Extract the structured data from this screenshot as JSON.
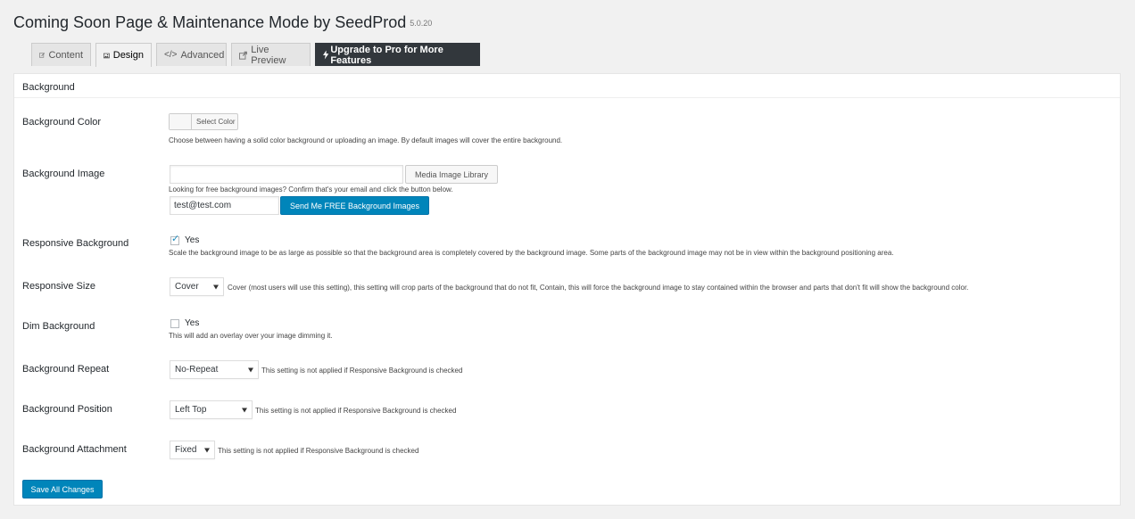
{
  "header": {
    "title": "Coming Soon Page & Maintenance Mode by SeedProd",
    "version": "5.0.20"
  },
  "tabs": [
    {
      "label": "Content",
      "icon": "edit-icon"
    },
    {
      "label": "Design",
      "icon": "image-icon"
    },
    {
      "label": "Advanced",
      "icon": "code-icon"
    },
    {
      "label": "Live Preview",
      "icon": "external-icon"
    },
    {
      "label": "Upgrade to Pro for More Features",
      "icon": "bolt-icon"
    }
  ],
  "section": {
    "title": "Background"
  },
  "fields": {
    "bg_color": {
      "label": "Background Color",
      "button": "Select Color",
      "desc": "Choose between having a solid color background or uploading an image. By default images will cover the entire background."
    },
    "bg_image": {
      "label": "Background Image",
      "input_value": "",
      "button": "Media Image Library",
      "desc": "Looking for free background images? Confirm that's your email and click the button below.",
      "email_value": "test@test.com",
      "send_button": "Send Me FREE Background Images"
    },
    "responsive": {
      "label": "Responsive Background",
      "checkbox_label": "Yes",
      "checked": true,
      "desc": "Scale the background image to be as large as possible so that the background area is completely covered by the background image. Some parts of the background image may not be in view within the background positioning area."
    },
    "size": {
      "label": "Responsive Size",
      "selected": "Cover",
      "desc": "Cover (most users will use this setting), this setting will crop parts of the background that do not fit, Contain, this will force the background image to stay contained within the browser and parts that don't fit will show the background color."
    },
    "dim": {
      "label": "Dim Background",
      "checkbox_label": "Yes",
      "checked": false,
      "desc": "This will add an overlay over your image dimming it."
    },
    "repeat": {
      "label": "Background Repeat",
      "selected": "No-Repeat",
      "desc": "This setting is not applied if Responsive Background is checked"
    },
    "position": {
      "label": "Background Position",
      "selected": "Left Top",
      "desc": "This setting is not applied if Responsive Background is checked"
    },
    "attachment": {
      "label": "Background Attachment",
      "selected": "Fixed",
      "desc": "This setting is not applied if Responsive Background is checked"
    }
  },
  "save_button": "Save All Changes",
  "colors": {
    "primary": "#0085ba",
    "pro_tab": "#32373c",
    "checkmark": "#1e8cbe"
  }
}
